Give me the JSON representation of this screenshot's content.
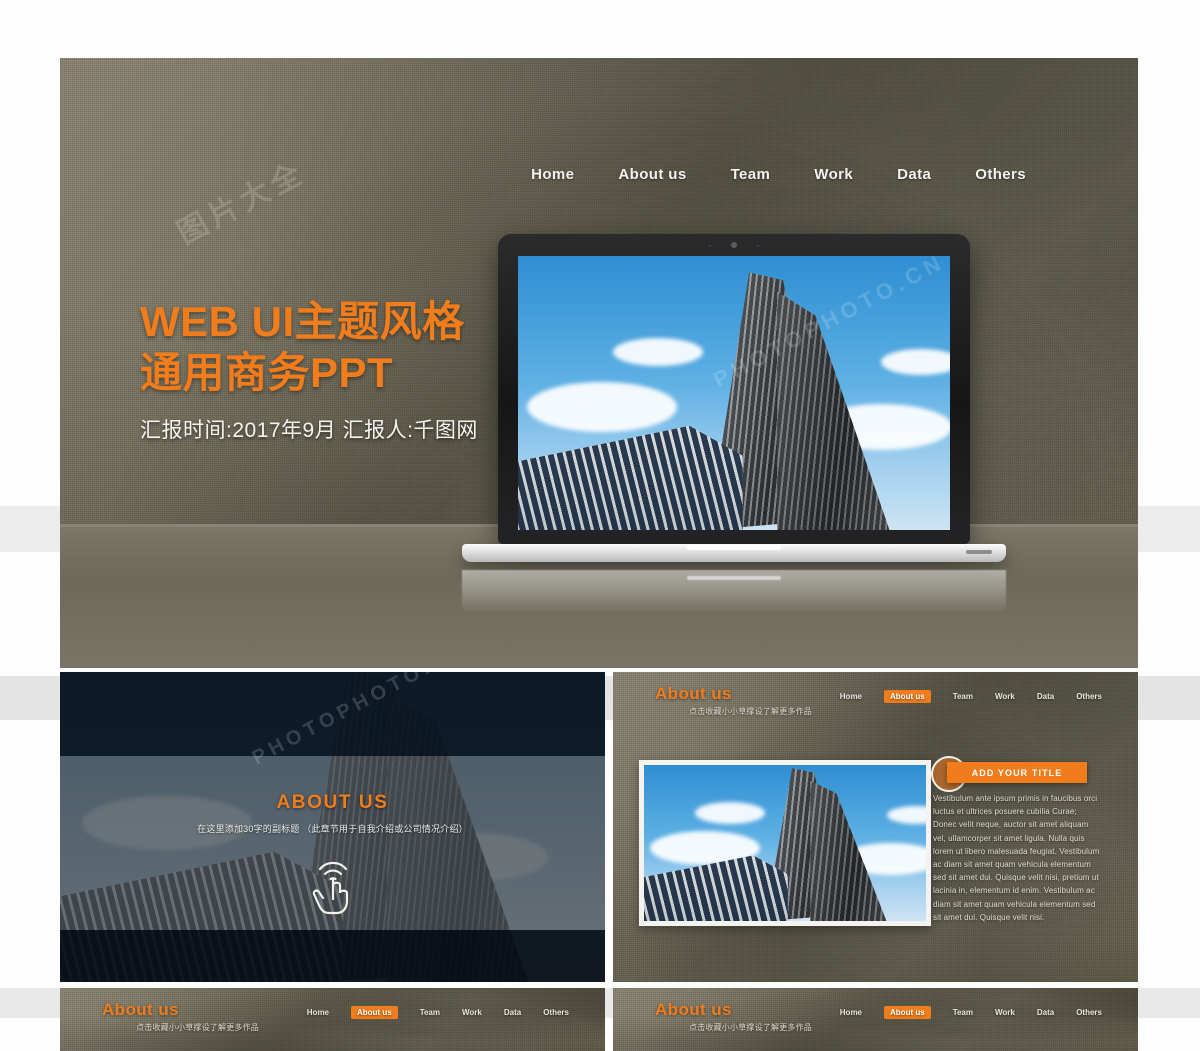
{
  "hero": {
    "nav": [
      {
        "label": "Home"
      },
      {
        "label": "About us"
      },
      {
        "label": "Team"
      },
      {
        "label": "Work"
      },
      {
        "label": "Data"
      },
      {
        "label": "Others"
      }
    ],
    "title_line1": "WEB UI主题风格",
    "title_line2": "通用商务PPT",
    "subtitle": "汇报时间:2017年9月    汇报人:千图网"
  },
  "about_dark": {
    "title": "ABOUT US",
    "subtitle": "在这里添加30字的副标题 （此章节用于自我介绍或公司情况介绍）",
    "icon": "hand-click-icon"
  },
  "about_content": {
    "title": "About us",
    "subtitle": "点击收藏小小草撑设了解更多作品",
    "nav": [
      {
        "label": "Home",
        "active": false
      },
      {
        "label": "About us",
        "active": true
      },
      {
        "label": "Team",
        "active": false
      },
      {
        "label": "Work",
        "active": false
      },
      {
        "label": "Data",
        "active": false
      },
      {
        "label": "Others",
        "active": false
      }
    ],
    "button_label": "ADD YOUR TITLE",
    "body": "Vestibulum ante ipsum primis in faucibus orci luctus et ultrices posuere cubilia Curae; Donec velit neque, auctor sit amet aliquam vel, ullamcorper sit amet ligula. Nulla quis lorem ut libero malesuada feugiat. Vestibulum ac diam sit amet quam vehicula elementum sed sit amet dui. Quisque velit nisi, pretium ut lacinia in, elementum id enim. Vestibulum ac diam sit amet quam vehicula elementum sed sit amet dui. Quisque velit nisi."
  },
  "about_bottom_left": {
    "title": "About us",
    "subtitle": "点击收藏小小草撑设了解更多作品",
    "nav": [
      {
        "label": "Home",
        "active": false
      },
      {
        "label": "About us",
        "active": true
      },
      {
        "label": "Team",
        "active": false
      },
      {
        "label": "Work",
        "active": false
      },
      {
        "label": "Data",
        "active": false
      },
      {
        "label": "Others",
        "active": false
      }
    ]
  },
  "about_bottom_right": {
    "title": "About us",
    "subtitle": "点击收藏小小草撑设了解更多作品",
    "nav": [
      {
        "label": "Home",
        "active": false
      },
      {
        "label": "About us",
        "active": true
      },
      {
        "label": "Team",
        "active": false
      },
      {
        "label": "Work",
        "active": false
      },
      {
        "label": "Data",
        "active": false
      },
      {
        "label": "Others",
        "active": false
      }
    ]
  },
  "watermarks": [
    "图片大全",
    "PHOTOPHOTO.CN",
    "千图网"
  ],
  "colors": {
    "accent_orange": "#f07c1b",
    "background_texture": "#6f6a5c",
    "dark_panel": "#14202c",
    "text_light": "#f3f2ee"
  }
}
